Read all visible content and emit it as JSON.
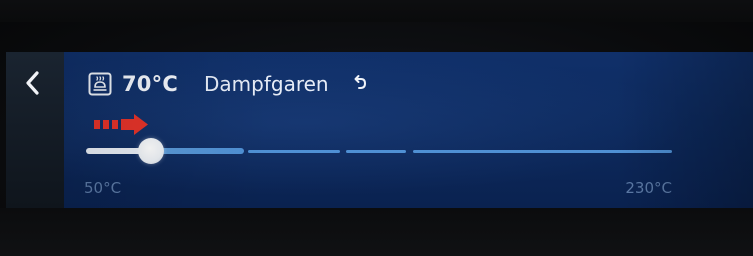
{
  "header": {
    "mode_icon": "steam-oven-icon",
    "temperature": "70°C",
    "mode_name": "Dampfgaren",
    "undo_icon": "undo-arrow-icon"
  },
  "navigation": {
    "back_icon": "chevron-left-icon"
  },
  "temperature_slider": {
    "min_label": "50°C",
    "max_label": "230°C",
    "min": 50,
    "max": 230,
    "value": 70,
    "fill_fraction": 0.27
  },
  "annotation": {
    "arrow_icon": "red-arrow-icon",
    "arrow_color": "#e5332a"
  },
  "colors": {
    "screen": "#0d2a5e",
    "track": "#4f90d4",
    "thumb": "#f4f6fa",
    "label": "#5c7aa6"
  }
}
